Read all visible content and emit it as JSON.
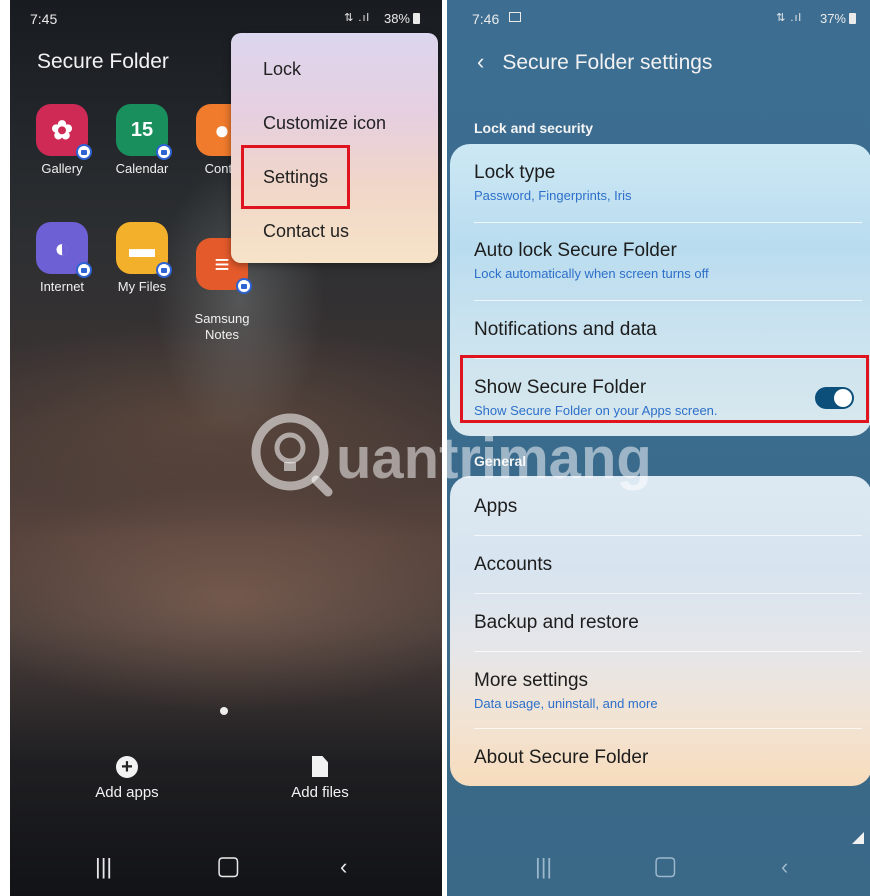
{
  "left": {
    "status": {
      "time": "7:45",
      "battery": "38%"
    },
    "title": "Secure Folder",
    "apps": [
      {
        "label": "Gallery",
        "color": "#cf2a55",
        "icon": "gallery-icon"
      },
      {
        "label": "Calendar",
        "color": "#1a8f5e",
        "icon": "calendar-icon",
        "glyph": "15"
      },
      {
        "label": "Conta",
        "color": "#f07b2c",
        "icon": "contacts-icon"
      },
      {
        "label": "Internet",
        "color": "#6d5fd4",
        "icon": "internet-icon"
      },
      {
        "label": "My Files",
        "color": "#f3b12b",
        "icon": "folder-icon"
      },
      {
        "label": "Samsung\nNotes",
        "color": "#e45a2b",
        "icon": "notes-icon"
      }
    ],
    "menu": {
      "items": [
        "Lock",
        "Customize icon",
        "Settings",
        "Contact us"
      ]
    },
    "bottom": {
      "add_apps": "Add apps",
      "add_files": "Add files"
    },
    "accent_highlight": "#e0141e"
  },
  "right": {
    "status": {
      "time": "7:46",
      "battery": "37%"
    },
    "header": "Secure Folder settings",
    "lock_section": {
      "title": "Lock and security",
      "items": [
        {
          "title": "Lock type",
          "subtitle": "Password, Fingerprints, Iris"
        },
        {
          "title": "Auto lock Secure Folder",
          "subtitle": "Lock automatically when screen turns off"
        },
        {
          "title": "Notifications and data",
          "subtitle": ""
        },
        {
          "title": "Show Secure Folder",
          "subtitle": "Show Secure Folder on your Apps screen.",
          "toggle": true
        }
      ]
    },
    "general_section": {
      "title": "General",
      "items": [
        {
          "title": "Apps",
          "subtitle": ""
        },
        {
          "title": "Accounts",
          "subtitle": ""
        },
        {
          "title": "Backup and restore",
          "subtitle": ""
        },
        {
          "title": "More settings",
          "subtitle": "Data usage, uninstall, and more"
        },
        {
          "title": "About Secure Folder",
          "subtitle": ""
        }
      ]
    },
    "subtitle_color": "#2d6fc9",
    "toggle_color": "#0b4f7a"
  },
  "watermark": "uantrimang"
}
